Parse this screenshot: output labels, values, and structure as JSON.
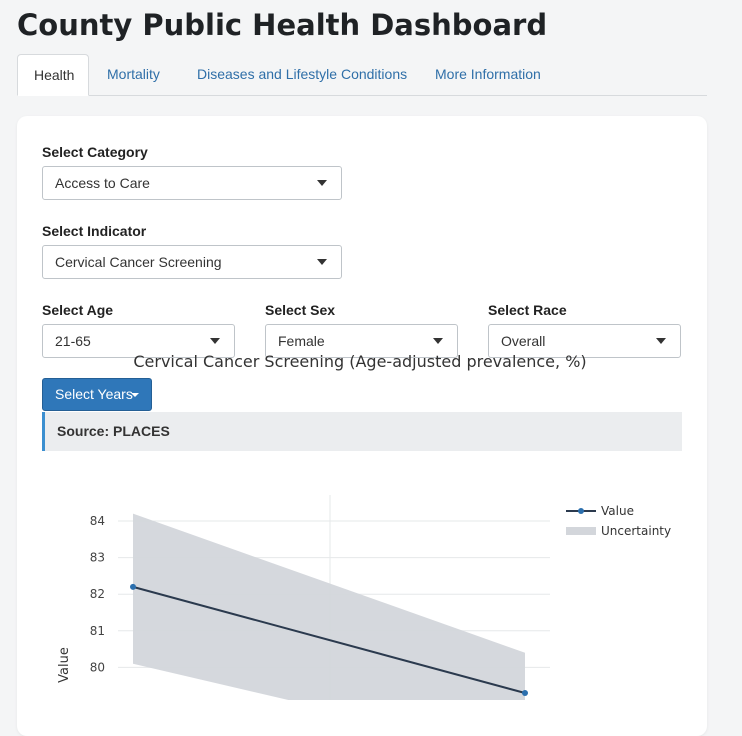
{
  "page_title": "County Public Health Dashboard",
  "tabs": [
    {
      "label": "Health",
      "active": true
    },
    {
      "label": "Mortality",
      "active": false
    },
    {
      "label": "Diseases and Lifestyle Conditions",
      "active": false
    },
    {
      "label": "More Information",
      "active": false
    }
  ],
  "filters": {
    "category": {
      "label": "Select Category",
      "value": "Access to Care"
    },
    "indicator": {
      "label": "Select Indicator",
      "value": "Cervical Cancer Screening"
    },
    "age": {
      "label": "Select Age",
      "value": "21-65"
    },
    "sex": {
      "label": "Select Sex",
      "value": "Female"
    },
    "race": {
      "label": "Select Race",
      "value": "Overall"
    }
  },
  "years_button": "Select Years",
  "source": "Source: PLACES",
  "colors": {
    "accent": "#2f77b9",
    "source_border": "#3b8fd0",
    "series_line": "#2b3a4e",
    "band_fill": "#d3d6db",
    "tab_link": "#2f6fa8"
  },
  "chart_data": {
    "type": "line",
    "title": "Cervical Cancer Screening (Age-adjusted prevalence, %)",
    "xlabel": "",
    "ylabel": "Value",
    "ylim": [
      79.2,
      84.3
    ],
    "yticks": [
      80,
      81,
      82,
      83,
      84
    ],
    "grid": true,
    "legend_position": "top-right",
    "series": [
      {
        "name": "Value",
        "kind": "line",
        "x": [
          0,
          1
        ],
        "values": [
          82.2,
          79.3
        ]
      },
      {
        "name": "Uncertainty",
        "kind": "band",
        "x": [
          0,
          1
        ],
        "upper": [
          84.2,
          80.4
        ],
        "lower": [
          80.1,
          77.6
        ]
      }
    ]
  }
}
